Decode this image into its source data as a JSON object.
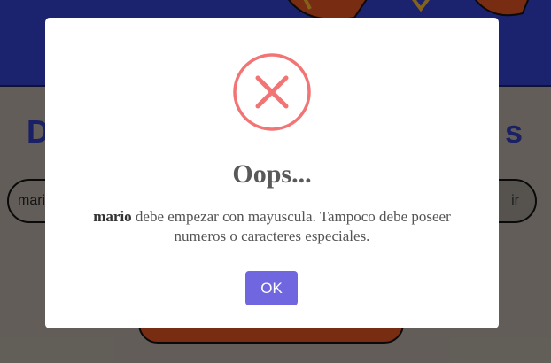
{
  "background": {
    "title_left": "D",
    "title_right": "s",
    "input_value": "mari",
    "button_label": "ir"
  },
  "modal": {
    "icon": "error-x-icon",
    "title": "Oops...",
    "message_bold": "mario",
    "message_rest": " debe empezar con mayuscula. Tampoco debe poseer numeros o caracteres especiales.",
    "ok_label": "OK"
  },
  "colors": {
    "header_blue": "#2d3ab8",
    "icon_red": "#f27474",
    "ok_purple": "#7066e0"
  }
}
